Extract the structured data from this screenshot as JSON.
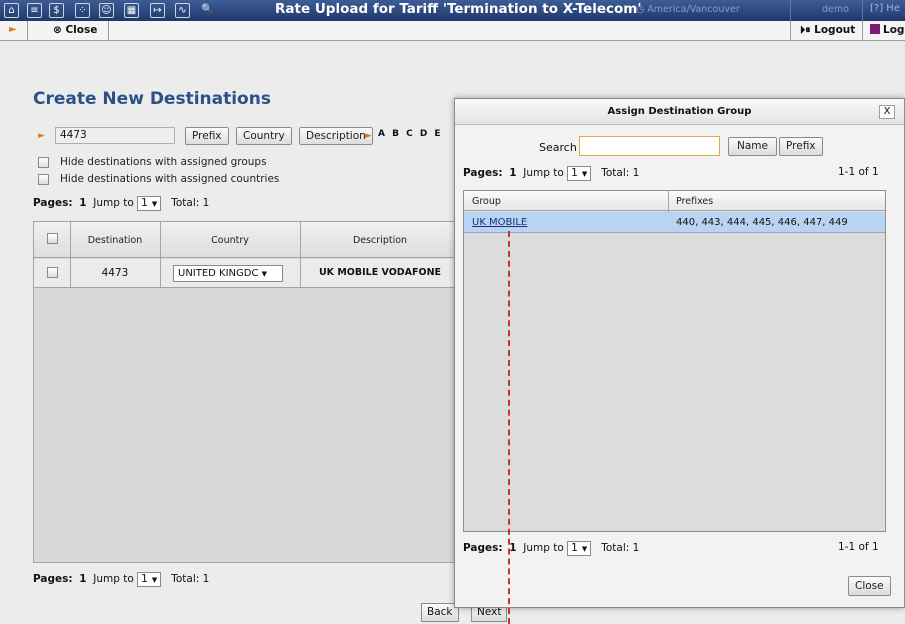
{
  "topbar": {
    "icons": [
      "home-icon",
      "list-icon",
      "dollar-icon",
      "grid-icon",
      "person-icon",
      "calc-icon",
      "export-icon",
      "chart-icon",
      "search-icon"
    ],
    "title": "Rate Upload for Tariff 'Termination to X-Telecom'",
    "timezone": "America/Vancouver",
    "user": "demo",
    "help": "He"
  },
  "toolbar2": {
    "close_label": "Close",
    "logout_label": "Logout",
    "log_label": "Log"
  },
  "main": {
    "title": "Create New Destinations",
    "filter_value": "4473",
    "btn_prefix": "Prefix",
    "btn_country": "Country",
    "btn_description": "Description",
    "alphabet": "A B C D E",
    "hide_groups": "Hide destinations with assigned groups",
    "hide_countries": "Hide destinations with assigned countries",
    "pager": {
      "label": "Pages:",
      "page": "1",
      "jump": "Jump to",
      "jump_value": "1",
      "total": "Total: 1"
    },
    "columns": {
      "destination": "Destination",
      "country": "Country",
      "description": "Description"
    },
    "rows": [
      {
        "destination": "4473",
        "country": "UNITED KINGDC",
        "description": "UK MOBILE VODAFONE"
      }
    ],
    "back_label": "Back",
    "next_label": "Next"
  },
  "modal": {
    "title": "Assign Destination Group",
    "close_x": "X",
    "search_label": "Search",
    "search_value": "",
    "btn_name": "Name",
    "btn_prefix": "Prefix",
    "pager": {
      "label": "Pages:",
      "page": "1",
      "jump": "Jump to",
      "jump_value": "1",
      "total": "Total: 1",
      "range": "1-1 of 1"
    },
    "columns": {
      "group": "Group",
      "prefixes": "Prefixes"
    },
    "rows": [
      {
        "group": "UK MOBILE",
        "prefixes": "440, 443, 444, 445, 446, 447, 449"
      }
    ],
    "close_label": "Close"
  },
  "colors": {
    "topbar": "#20386a",
    "title_blue": "#2b5286",
    "accent_orange": "#e07b1c",
    "selected_row": "#b9d4f2",
    "annotation_arrow": "#c0392b"
  }
}
